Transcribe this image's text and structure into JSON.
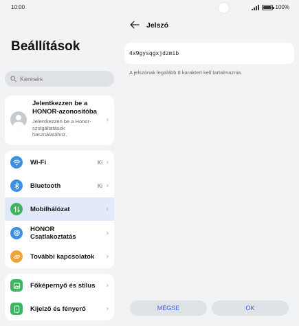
{
  "status_bar": {
    "time": "10:00",
    "battery": "100%",
    "battery_level": 1.0
  },
  "left": {
    "title": "Beállítások",
    "search": {
      "placeholder": "Keresés",
      "icon": "search-icon"
    },
    "account": {
      "title": "Jelentkezzen be a HONOR-azonosítóba",
      "subtitle": "Jelentkezzen be a Honor-szolgáltatások használatához."
    },
    "groups": [
      {
        "items": [
          {
            "label": "Wi-Fi",
            "value": "Ki",
            "icon": "wifi-icon",
            "color": "#3d8fe3"
          },
          {
            "label": "Bluetooth",
            "value": "Ki",
            "icon": "bluetooth-icon",
            "color": "#3d8fe3"
          },
          {
            "label": "Mobilhálózat",
            "value": "",
            "icon": "mobile-data-icon",
            "color": "#3bb65f",
            "selected": true
          },
          {
            "label": "HONOR Csatlakoztatás",
            "value": "",
            "icon": "honor-connect-icon",
            "color": "#3d8fe3"
          },
          {
            "label": "További kapcsolatok",
            "value": "",
            "icon": "link-icon",
            "color": "#f0a338"
          }
        ]
      },
      {
        "items": [
          {
            "label": "Főképernyő és stílus",
            "value": "",
            "icon": "image-icon",
            "color": "#3bb65f"
          },
          {
            "label": "Kijelző és fényerő",
            "value": "",
            "icon": "display-icon",
            "color": "#3bb65f"
          }
        ]
      }
    ]
  },
  "right": {
    "title": "Jelszó",
    "password_value": "4x9gysqgxjdzmib",
    "hint": "A jelszónak legalább 8 karaktert kell tartalmaznia.",
    "cancel_label": "MÉGSE",
    "ok_label": "OK"
  },
  "colors": {
    "accent": "#2f62e6",
    "selected_row": "#e2e9fb",
    "background": "#f1f3f5"
  }
}
